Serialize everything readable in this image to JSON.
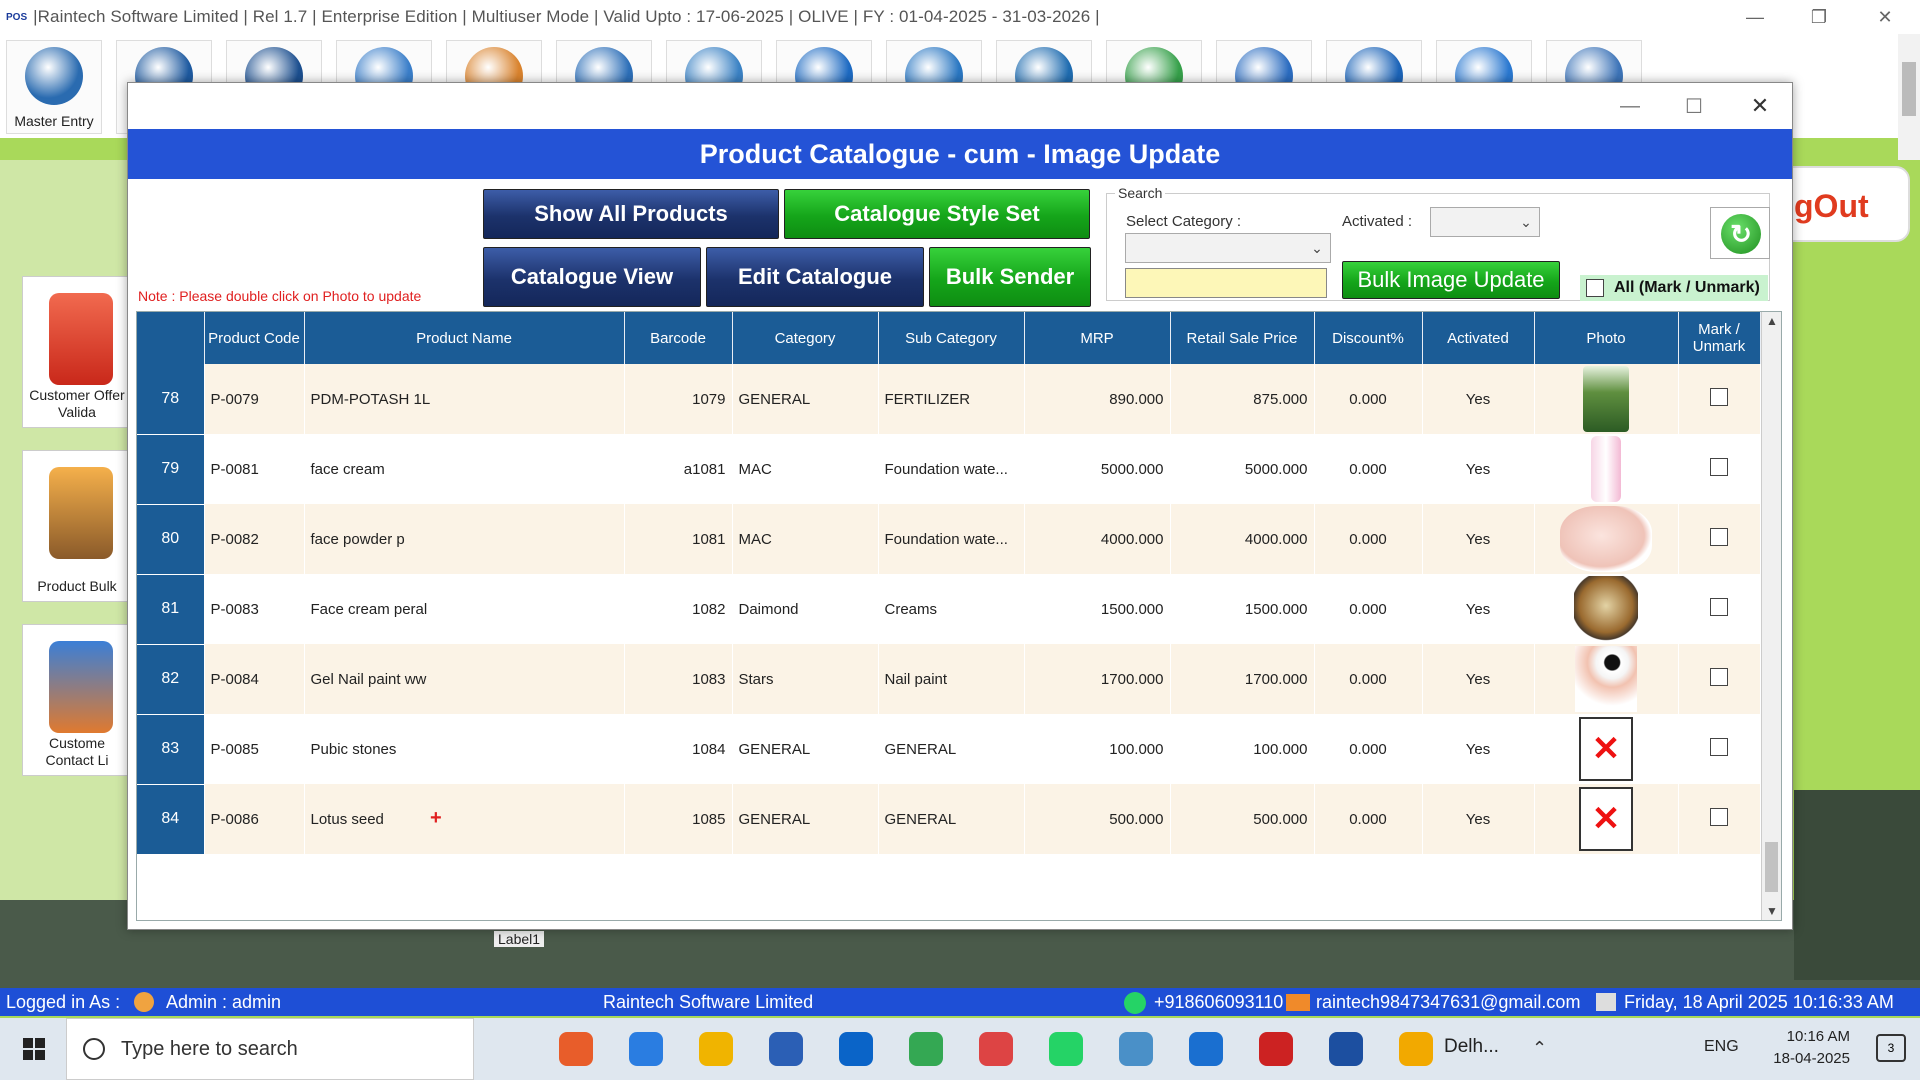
{
  "app": {
    "pos_badge": "POS",
    "title": "|Raintech Software Limited |  Rel 1.7  |  Enterprise Edition  |  Multiuser Mode  |  Valid Upto : 17-06-2025  |  OLIVE  |  FY : 01-04-2025  -  31-03-2026  |",
    "controls": {
      "minimize": "—",
      "restore": "❐",
      "close": "✕"
    }
  },
  "ribbon": {
    "first_label": "Master Entry",
    "colors": [
      "#2a6bb0",
      "#1e5aa0",
      "#1c4f8f",
      "#3a7ec9",
      "#d9832e",
      "#2d6fb8",
      "#3b82c4",
      "#1d6ac2",
      "#2a77c2",
      "#1f6cb0",
      "#36a04a",
      "#2b6cc0",
      "#1c64b8",
      "#2a78d0",
      "#3d74b8"
    ]
  },
  "side_cards": [
    {
      "label": "Customer Offer Valida",
      "color": "#e0402f"
    },
    {
      "label": "Product Bulk",
      "color": "#e07a1f"
    },
    {
      "label": "Custome Contact Li",
      "color": "#d95b22"
    }
  ],
  "logout_text": "gOut",
  "bg_label1": "Label1",
  "dialog": {
    "title": "Product Catalogue - cum - Image Update",
    "controls": {
      "minimize": "—",
      "maximize": "☐",
      "close": "✕"
    },
    "buttons": {
      "show_all": "Show All Products",
      "style_set": "Catalogue Style Set",
      "catalogue_view": "Catalogue View",
      "edit_catalogue": "Edit Catalogue",
      "bulk_sender": "Bulk Sender",
      "bulk_image_update": "Bulk Image Update"
    },
    "note": "Note : Please double click on Photo to update",
    "search": {
      "legend": "Search",
      "category_label": "Select Category :",
      "category_value": "",
      "activated_label": "Activated :",
      "activated_value": "",
      "category_text": ""
    },
    "mark_all_label": "All (Mark / Unmark)"
  },
  "table": {
    "columns": [
      "",
      "Product Code",
      "Product Name",
      "Barcode",
      "Category",
      "Sub Category",
      "MRP",
      "Retail Sale Price",
      "Discount%",
      "Activated",
      "Photo",
      "Mark / Unmark"
    ],
    "rows": [
      {
        "no": "78",
        "code": "P-0079",
        "name": "PDM-POTASH 1L",
        "barcode": "1079",
        "category": "GENERAL",
        "sub": "FERTILIZER",
        "mrp": "890.000",
        "rsp": "875.000",
        "disc": "0.000",
        "act": "Yes",
        "photo": "fertilizer-bag",
        "marked": false
      },
      {
        "no": "79",
        "code": "P-0081",
        "name": "face cream",
        "barcode": "a1081",
        "category": "MAC",
        "sub": "Foundation wate...",
        "mrp": "5000.000",
        "rsp": "5000.000",
        "disc": "0.000",
        "act": "Yes",
        "photo": "cream-tube",
        "marked": false
      },
      {
        "no": "80",
        "code": "P-0082",
        "name": "face powder p",
        "barcode": "1081",
        "category": "MAC",
        "sub": "Foundation wate...",
        "mrp": "4000.000",
        "rsp": "4000.000",
        "disc": "0.000",
        "act": "Yes",
        "photo": "powder-puff",
        "marked": false
      },
      {
        "no": "81",
        "code": "P-0083",
        "name": "Face cream peral",
        "barcode": "1082",
        "category": "Daimond",
        "sub": "Creams",
        "mrp": "1500.000",
        "rsp": "1500.000",
        "disc": "0.000",
        "act": "Yes",
        "photo": "cream-jar",
        "marked": false
      },
      {
        "no": "82",
        "code": "P-0084",
        "name": "Gel Nail paint ww",
        "barcode": "1083",
        "category": "Stars",
        "sub": "Nail paint",
        "mrp": "1700.000",
        "rsp": "1700.000",
        "disc": "0.000",
        "act": "Yes",
        "photo": "nail-paint",
        "marked": false
      },
      {
        "no": "83",
        "code": "P-0085",
        "name": "Pubic stones",
        "barcode": "1084",
        "category": "GENERAL",
        "sub": "GENERAL",
        "mrp": "100.000",
        "rsp": "100.000",
        "disc": "0.000",
        "act": "Yes",
        "photo": "missing",
        "marked": false
      },
      {
        "no": "84",
        "code": "P-0086",
        "name": "Lotus seed",
        "barcode": "1085",
        "category": "GENERAL",
        "sub": "GENERAL",
        "mrp": "500.000",
        "rsp": "500.000",
        "disc": "0.000",
        "act": "Yes",
        "photo": "missing",
        "marked": false
      }
    ],
    "scroll_up": "▲",
    "scroll_down": "▼"
  },
  "plus_marker": "+",
  "missing_mark": "✕",
  "status": {
    "logged_in": "Logged in As :",
    "user": "Admin  :  admin",
    "company": "Raintech Software Limited",
    "phone": "+918606093110",
    "email": "raintech9847347631@gmail.com",
    "datetime": "Friday, 18 April 2025 10:16:33 AM"
  },
  "taskbar": {
    "search_placeholder": "Type here to search",
    "weather": "Delh...",
    "lang": "ENG",
    "time": "10:16 AM",
    "date": "18-04-2025",
    "notif_count": "3",
    "app_colors": [
      "#e85d2a",
      "#2a7de1",
      "#f0b400",
      "#2b5fb5",
      "#0a64c8",
      "#34a853",
      "#d44",
      "#25d366",
      "#4a90c8",
      "#1a6fd0",
      "#c22",
      "#1c4fa0",
      "#f2a900"
    ]
  },
  "accent_colors": {
    "dialog_header": "#2453d6",
    "grid_header": "#1b5c96",
    "navy_button": "#1c326b",
    "green_button": "#15a51a",
    "status_bar": "#1e4fd6"
  }
}
